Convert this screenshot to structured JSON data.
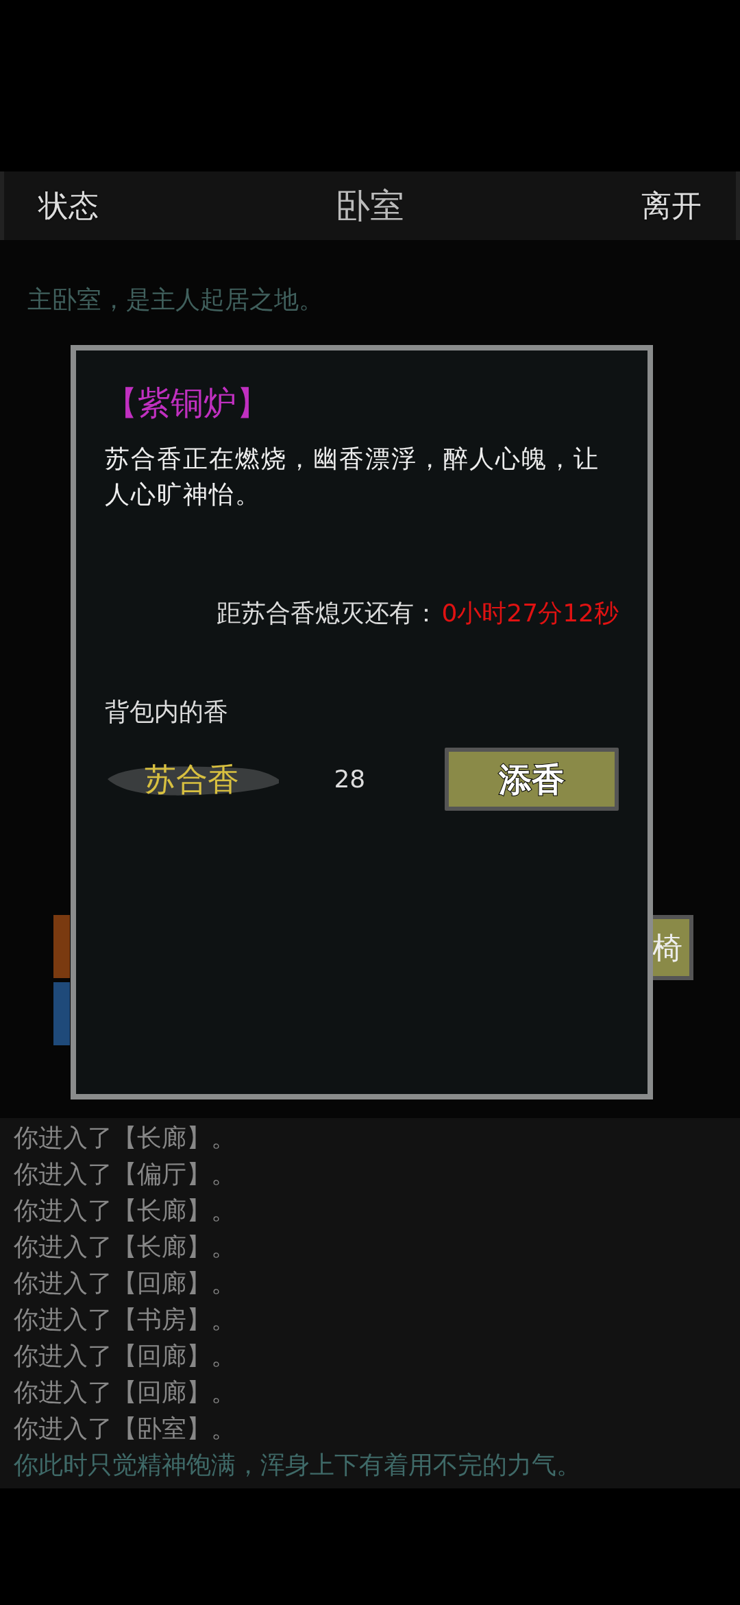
{
  "header": {
    "left": "状态",
    "title": "卧室",
    "right": "离开"
  },
  "room": {
    "description": "主卧室，是主人起居之地。",
    "items": [
      {
        "kind": "emblem"
      },
      {
        "label": "椅",
        "kind": "accent"
      }
    ]
  },
  "dialog": {
    "title": "【紫铜炉】",
    "description": "苏合香正在燃烧，幽香漂浮，醉人心魄，让人心旷神怡。",
    "countdown_label": "距苏合香熄灭还有：",
    "countdown": "0小时27分12秒",
    "bag_label": "背包内的香",
    "incense": [
      {
        "name": "苏合香",
        "count": "28",
        "button": "添香"
      }
    ]
  },
  "log": [
    {
      "text": "你进入了【长廊】。",
      "kind": "event"
    },
    {
      "text": "你进入了【偏厅】。",
      "kind": "event"
    },
    {
      "text": "你进入了【长廊】。",
      "kind": "event"
    },
    {
      "text": "你进入了【长廊】。",
      "kind": "event"
    },
    {
      "text": "你进入了【回廊】。",
      "kind": "event"
    },
    {
      "text": "你进入了【书房】。",
      "kind": "event"
    },
    {
      "text": "你进入了【回廊】。",
      "kind": "event"
    },
    {
      "text": "你进入了【回廊】。",
      "kind": "event"
    },
    {
      "text": "你进入了【卧室】。",
      "kind": "event"
    },
    {
      "text": "你此时只觉精神饱满，浑身上下有着用不完的力气。",
      "kind": "status"
    }
  ]
}
